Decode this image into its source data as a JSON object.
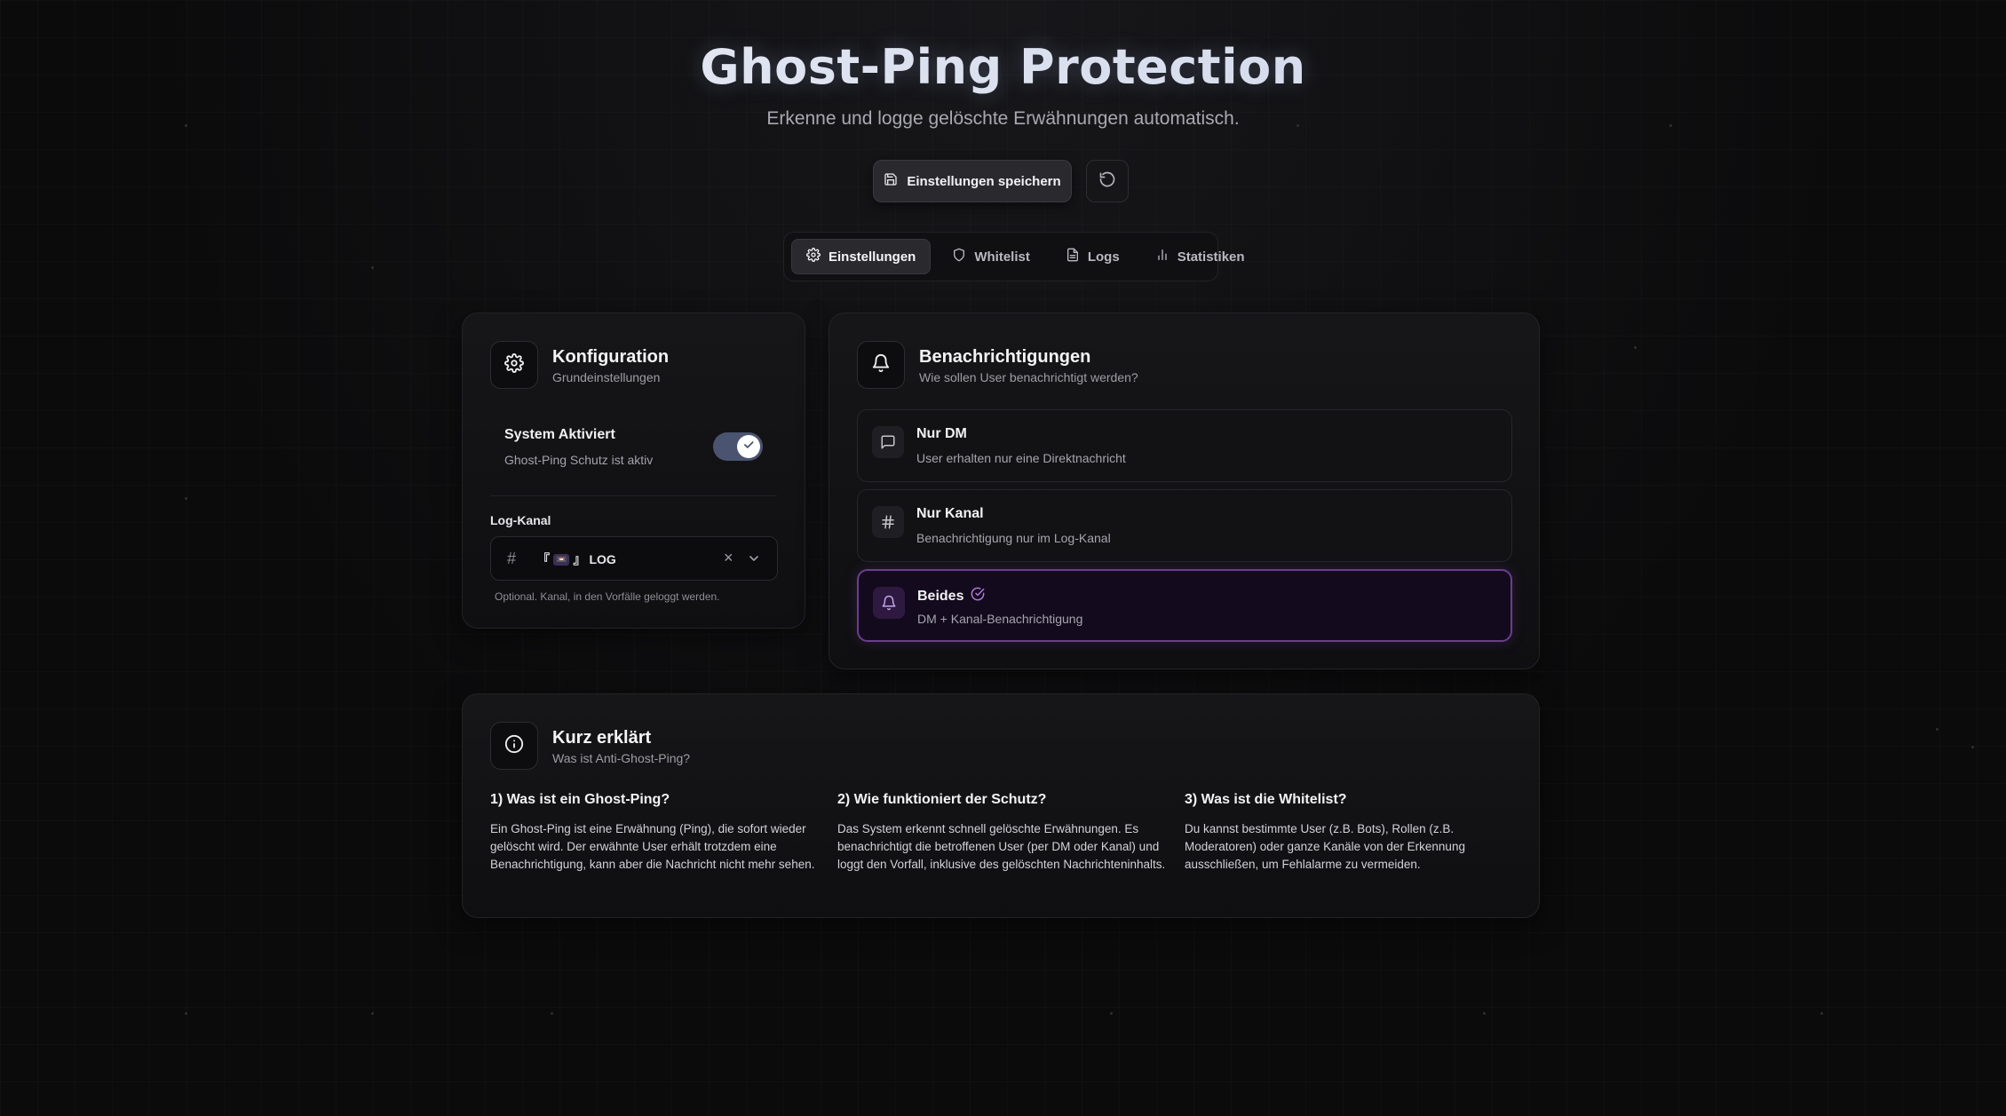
{
  "header": {
    "title": "Ghost-Ping Protection",
    "subtitle": "Erkenne und logge gelöschte Erwähnungen automatisch.",
    "save_label": "Einstellungen speichern"
  },
  "tabs": [
    {
      "label": "Einstellungen",
      "icon": "gear-icon",
      "active": true
    },
    {
      "label": "Whitelist",
      "icon": "shield-icon",
      "active": false
    },
    {
      "label": "Logs",
      "icon": "file-icon",
      "active": false
    },
    {
      "label": "Statistiken",
      "icon": "bar-chart-icon",
      "active": false
    }
  ],
  "config": {
    "title": "Konfiguration",
    "subtitle": "Grundeinstellungen",
    "toggle_title": "System Aktiviert",
    "toggle_sub": "Ghost-Ping Schutz ist aktiv",
    "toggle_on": true,
    "log_label": "Log-Kanal",
    "log_prefix": "『",
    "log_emoji": "📼",
    "log_suffix": "』",
    "log_value": "LOG",
    "hint": "Optional. Kanal, in den Vorfälle geloggt werden."
  },
  "notify": {
    "title": "Benachrichtigungen",
    "subtitle": "Wie sollen User benachrichtigt werden?",
    "options": [
      {
        "title": "Nur DM",
        "sub": "User erhalten nur eine Direktnachricht",
        "icon": "message-icon",
        "selected": false
      },
      {
        "title": "Nur Kanal",
        "sub": "Benachrichtigung nur im Log-Kanal",
        "icon": "hash-icon",
        "selected": false
      },
      {
        "title": "Beides",
        "sub": "DM + Kanal-Benachrichtigung",
        "icon": "bell-icon",
        "selected": true
      }
    ]
  },
  "info": {
    "title": "Kurz erklärt",
    "subtitle": "Was ist Anti-Ghost-Ping?",
    "cols": [
      {
        "heading": "1) Was ist ein Ghost-Ping?",
        "text": "Ein Ghost-Ping ist eine Erwähnung (Ping), die sofort wieder gelöscht wird. Der erwähnte User erhält trotzdem eine Benachrichtigung, kann aber die Nachricht nicht mehr sehen."
      },
      {
        "heading": "2) Wie funktioniert der Schutz?",
        "text": "Das System erkennt schnell gelöschte Erwähnungen. Es benachrichtigt die betroffenen User (per DM oder Kanal) und loggt den Vorfall, inklusive des gelöschten Nachrichteninhalts."
      },
      {
        "heading": "3) Was ist die Whitelist?",
        "text": "Du kannst bestimmte User (z.B. Bots), Rollen (z.B. Moderatoren) oder ganze Kanäle von der Erkennung ausschließen, um Fehlalarme zu vermeiden."
      }
    ]
  },
  "colors": {
    "accent": "#6a3e8e",
    "toggle": "#4a5470",
    "background": "#0b0b0c"
  }
}
